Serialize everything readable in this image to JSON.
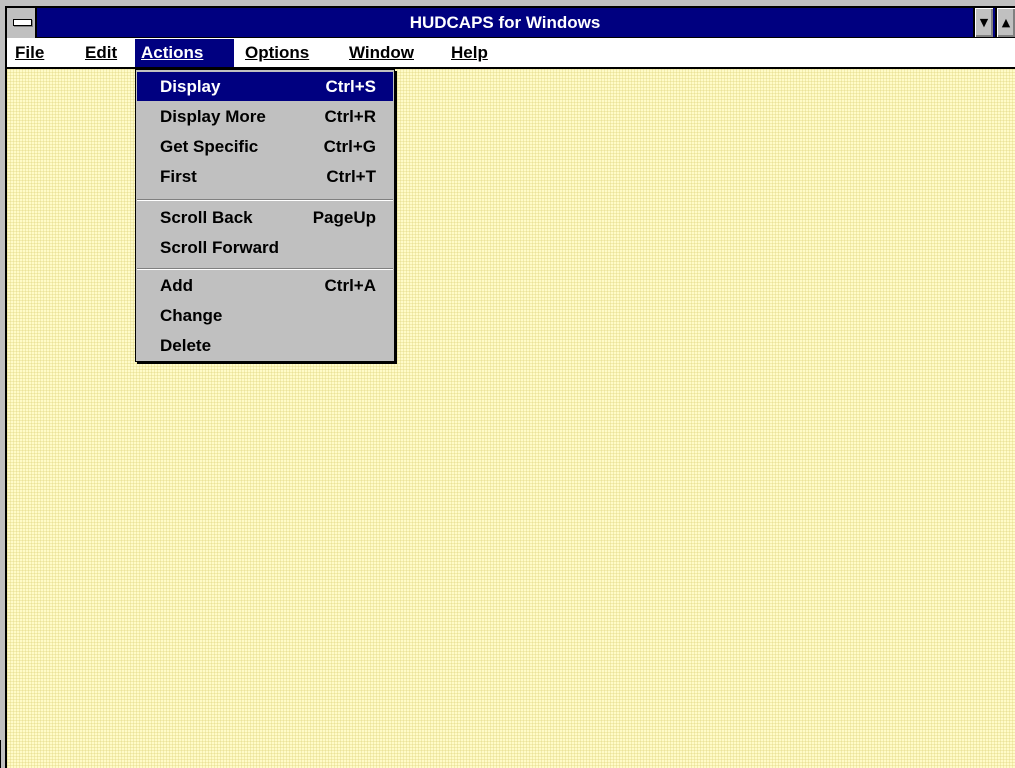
{
  "window": {
    "title": "HUDCAPS for Windows"
  },
  "menubar": {
    "items": [
      {
        "label": "File"
      },
      {
        "label": "Edit"
      },
      {
        "label": "Actions"
      },
      {
        "label": "Options"
      },
      {
        "label": "Window"
      },
      {
        "label": "Help"
      }
    ]
  },
  "actions_menu": {
    "items": [
      {
        "label": "Display",
        "accel": "Ctrl+S"
      },
      {
        "label": "Display More",
        "accel": "Ctrl+R"
      },
      {
        "label": "Get Specific",
        "accel": "Ctrl+G"
      },
      {
        "label": "First",
        "accel": "Ctrl+T"
      },
      {
        "label": "Scroll Back",
        "accel": "PageUp"
      },
      {
        "label": "Scroll Forward",
        "accel": ""
      },
      {
        "label": "Add",
        "accel": "Ctrl+A"
      },
      {
        "label": "Change",
        "accel": ""
      },
      {
        "label": "Delete",
        "accel": ""
      }
    ]
  },
  "colors": {
    "titlebar": "#000080",
    "menu_highlight": "#000080",
    "menu_background": "#c0c0c0",
    "client_background": "#fffbc8"
  },
  "icons": {
    "system_menu": "system-menu-icon",
    "minimize": "minimize-arrow-icon",
    "maximize": "maximize-arrow-icon"
  }
}
